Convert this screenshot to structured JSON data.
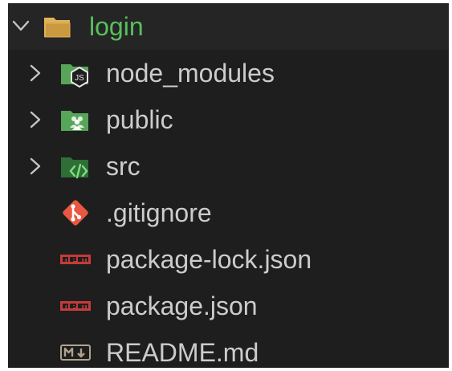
{
  "explorer": {
    "root": {
      "label": "login",
      "icon": "folder-open-icon",
      "expanded": true,
      "color": "#57c05b"
    },
    "items": [
      {
        "label": "node_modules",
        "type": "folder",
        "icon": "node-modules-folder-icon",
        "expanded": false
      },
      {
        "label": "public",
        "type": "folder",
        "icon": "public-folder-icon",
        "expanded": false
      },
      {
        "label": "src",
        "type": "folder",
        "icon": "src-folder-icon",
        "expanded": false
      },
      {
        "label": ".gitignore",
        "type": "file",
        "icon": "git-icon"
      },
      {
        "label": "package-lock.json",
        "type": "file",
        "icon": "npm-icon"
      },
      {
        "label": "package.json",
        "type": "file",
        "icon": "npm-icon"
      },
      {
        "label": "README.md",
        "type": "file",
        "icon": "markdown-icon"
      }
    ]
  },
  "colors": {
    "background": "#1e1e1e",
    "root_row_background": "#252526",
    "text": "#cccccc",
    "chevron": "#c5c5c5",
    "folder_green": "#56a558",
    "git": "#e8573f",
    "npm": "#c43b3b",
    "markdown": "#b0a28c"
  }
}
